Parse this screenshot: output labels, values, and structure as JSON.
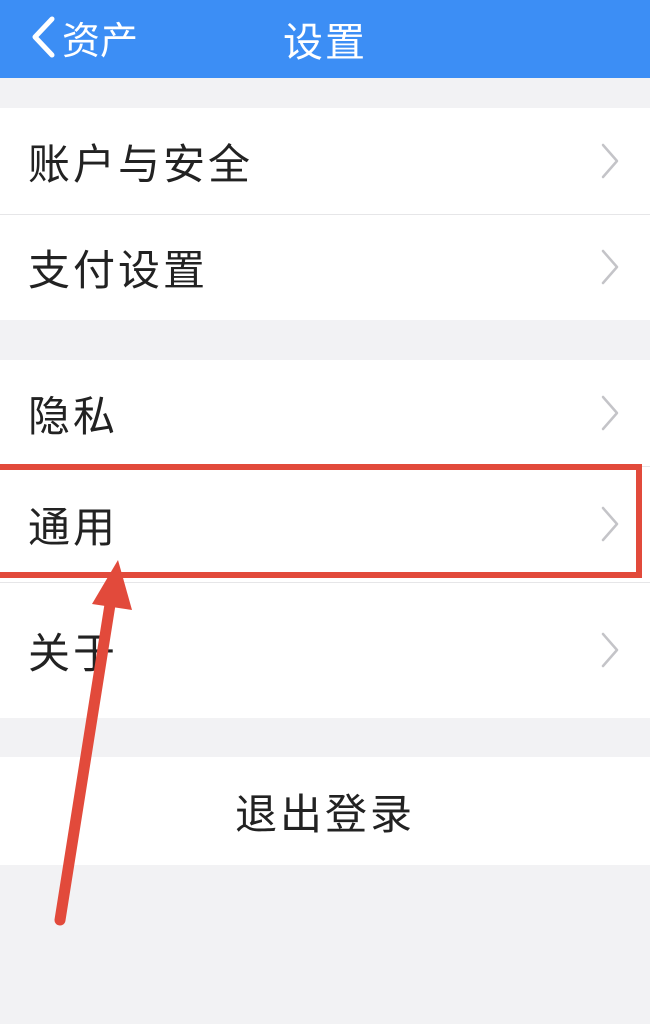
{
  "navbar": {
    "back_label": "资产",
    "title": "设置"
  },
  "groups": [
    {
      "items": [
        {
          "label": "账户与安全"
        },
        {
          "label": "支付设置"
        }
      ]
    },
    {
      "items": [
        {
          "label": "隐私"
        },
        {
          "label": "通用"
        },
        {
          "label": "关于"
        }
      ]
    }
  ],
  "logout_label": "退出登录",
  "colors": {
    "navbar": "#3c8ef5",
    "annotation": "#e24a3b",
    "background": "#f2f2f4"
  },
  "icons": {
    "back": "chevron-left-icon",
    "row": "chevron-right-icon"
  }
}
